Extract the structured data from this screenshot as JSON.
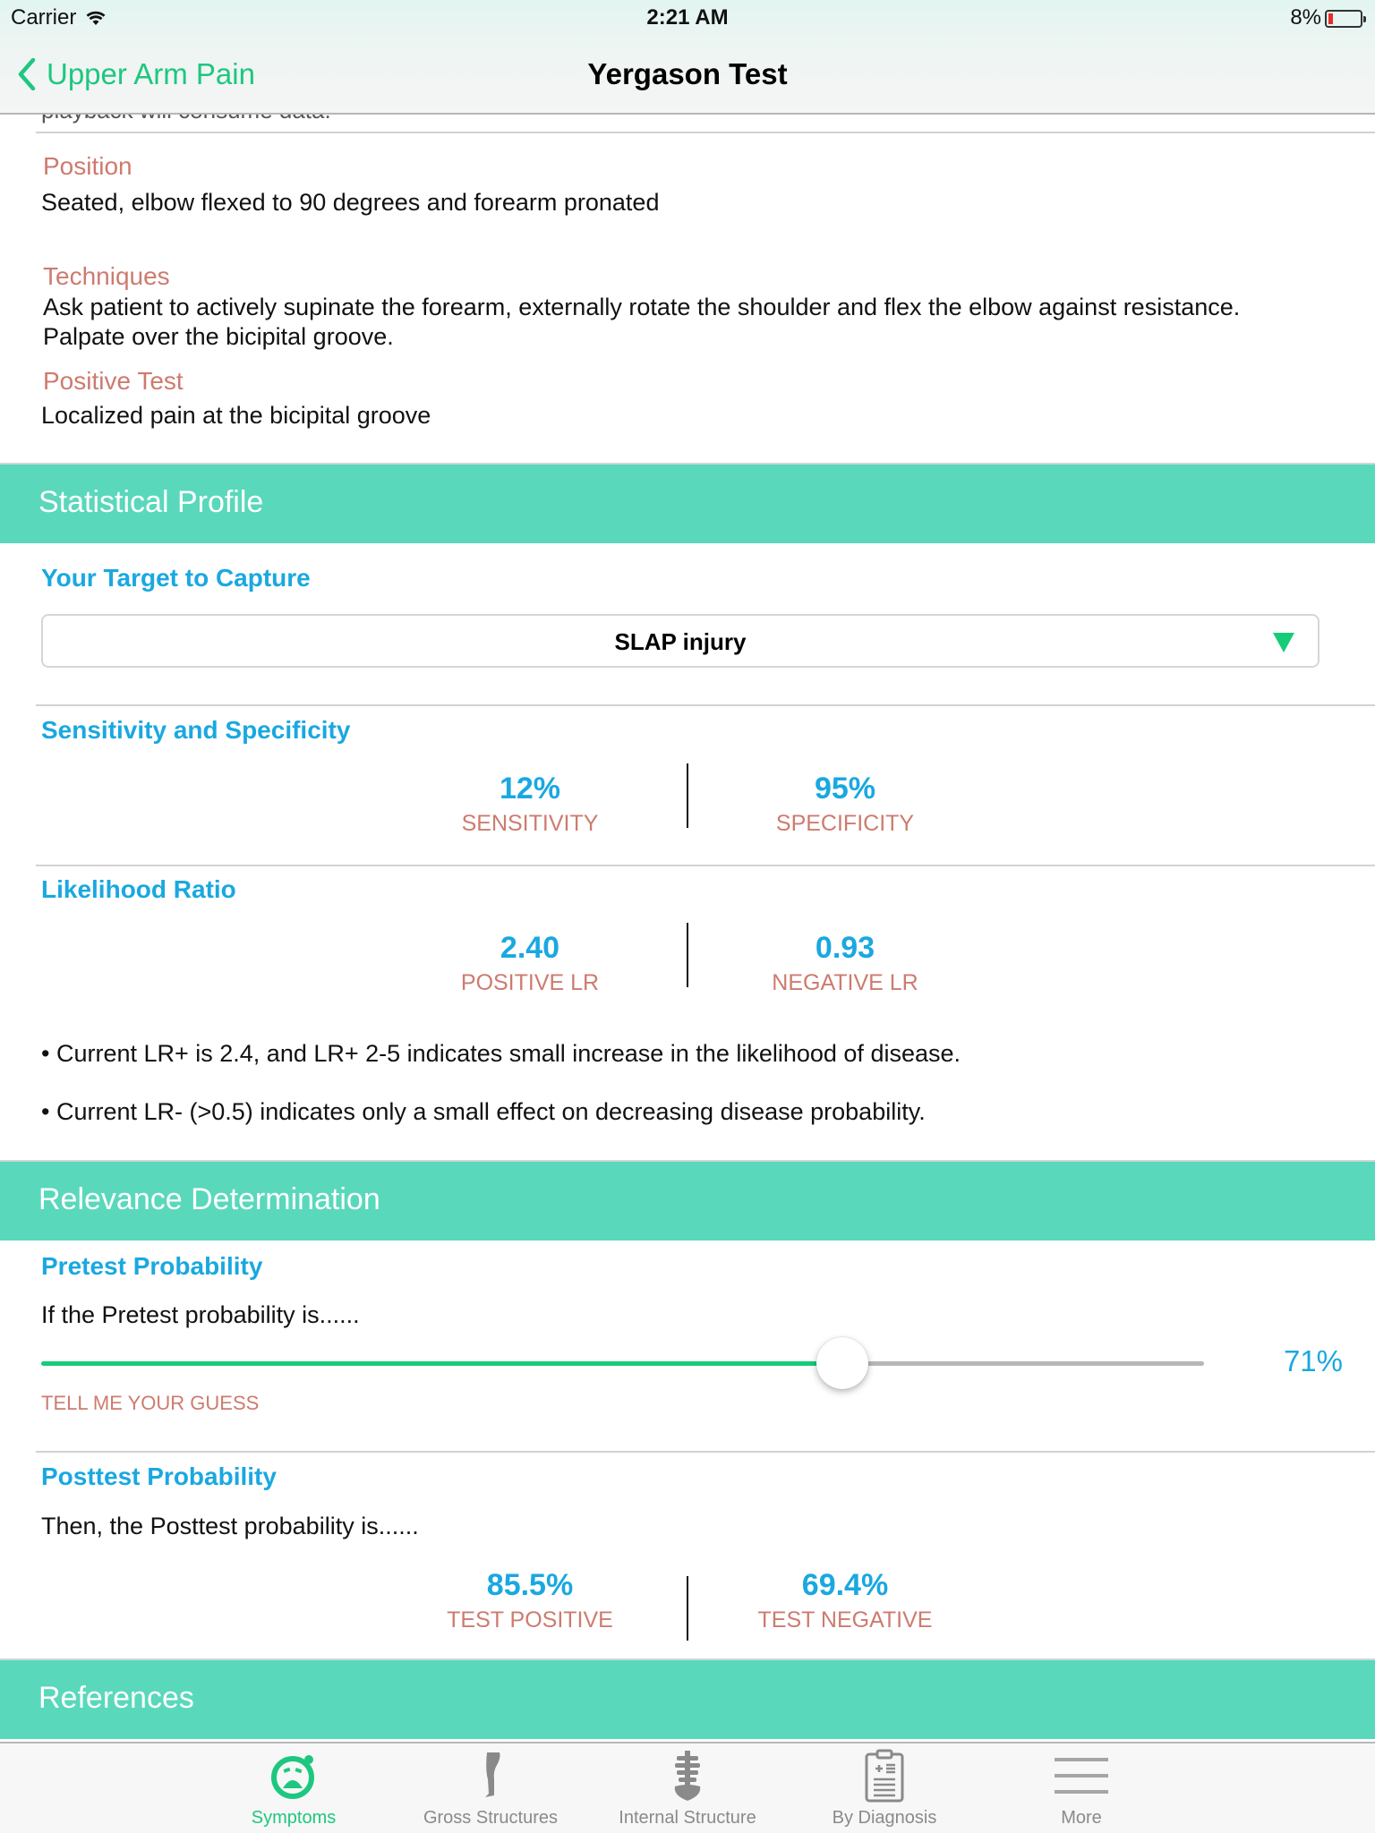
{
  "status_bar": {
    "carrier": "Carrier",
    "time": "2:21 AM",
    "battery_percent": "8%"
  },
  "nav": {
    "back_label": "Upper Arm Pain",
    "title": "Yergason Test"
  },
  "clipped_text": "playback will consume data.",
  "details": {
    "position_label": "Position",
    "position_text": "Seated, elbow flexed to 90 degrees and forearm pronated",
    "techniques_label": "Techniques",
    "techniques_text": "Ask patient to actively supinate the forearm, externally rotate the shoulder and flex the elbow against resistance.  Palpate over the bicipital groove.",
    "positive_test_label": "Positive Test",
    "positive_test_text": "Localized pain at the bicipital groove"
  },
  "statistical_profile": {
    "band_title": "Statistical Profile",
    "target_title": "Your Target to Capture",
    "target_selected": "SLAP injury",
    "sens_spec_title": "Sensitivity and Specificity",
    "sensitivity_value": "12%",
    "sensitivity_label": "SENSITIVITY",
    "specificity_value": "95%",
    "specificity_label": "SPECIFICITY",
    "lr_title": "Likelihood Ratio",
    "positive_lr_value": "2.40",
    "positive_lr_label": "POSITIVE LR",
    "negative_lr_value": "0.93",
    "negative_lr_label": "NEGATIVE LR",
    "bullets": [
      "• Current LR+ is 2.4, and LR+ 2-5 indicates small increase in the likelihood of disease.",
      "• Current LR- (>0.5) indicates only a small effect on decreasing disease probability."
    ]
  },
  "relevance": {
    "band_title": "Relevance Determination",
    "pretest_title": "Pretest Probability",
    "pretest_prompt": "If the Pretest probability is......",
    "pretest_value_percent": 71,
    "pretest_value_label": "71%",
    "pretest_hint": "TELL ME YOUR GUESS",
    "posttest_title": "Posttest Probability",
    "posttest_prompt": "Then, the Posttest probability is......",
    "test_positive_value": "85.5%",
    "test_positive_label": "TEST POSITIVE",
    "test_negative_value": "69.4%",
    "test_negative_label": "TEST NEGATIVE"
  },
  "references": {
    "band_title": "References"
  },
  "tabbar": {
    "items": [
      {
        "label": "Symptoms",
        "icon": "symptoms-face-icon",
        "active": true
      },
      {
        "label": "Gross Structures",
        "icon": "leg-icon",
        "active": false
      },
      {
        "label": "Internal Structure",
        "icon": "spine-icon",
        "active": false
      },
      {
        "label": "By Diagnosis",
        "icon": "clipboard-icon",
        "active": false
      },
      {
        "label": "More",
        "icon": "menu-icon",
        "active": false
      }
    ]
  },
  "colors": {
    "accent_green": "#1ec77f",
    "band_teal": "#5ad8bb",
    "title_blue": "#1aa8e0",
    "label_rose": "#cd7b6f",
    "battery_low_red": "#e62b2b"
  }
}
